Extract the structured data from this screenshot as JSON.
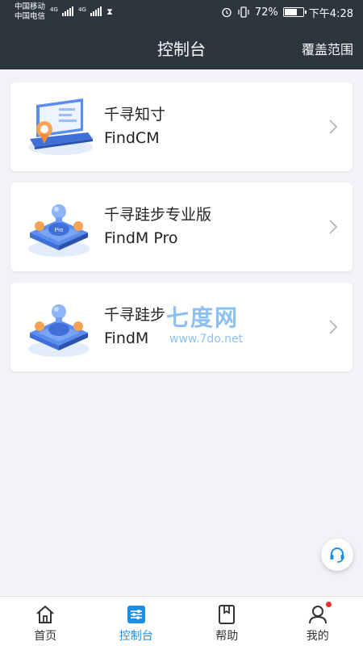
{
  "status_bar": {
    "carrier1": "中国移动",
    "carrier2": "中国电信",
    "net1": "4G",
    "net2": "4G",
    "battery": "72%",
    "battery_level": 0.72,
    "time": "下午4:28"
  },
  "header": {
    "title": "控制台",
    "right_action": "覆盖范围"
  },
  "products": [
    {
      "name": "千寻知寸",
      "subtitle": "FindCM",
      "icon": "laptop-illustration"
    },
    {
      "name": "千寻跬步专业版",
      "subtitle": "FindM Pro",
      "icon": "locator-pro-illustration",
      "badge": "Pro"
    },
    {
      "name": "千寻跬步",
      "subtitle": "FindM",
      "icon": "locator-illustration"
    }
  ],
  "watermark": {
    "text1": "七度网",
    "text2": "www.7do.net"
  },
  "bottom_nav": {
    "items": [
      {
        "label": "首页",
        "icon": "home-icon"
      },
      {
        "label": "控制台",
        "icon": "console-icon",
        "active": true
      },
      {
        "label": "帮助",
        "icon": "book-icon"
      },
      {
        "label": "我的",
        "icon": "user-icon",
        "has_dot": true
      }
    ]
  },
  "colors": {
    "header_bg": "#2d353f",
    "accent": "#1a8fe3",
    "page_bg": "#f2f2f7",
    "dot": "#e8332a"
  }
}
